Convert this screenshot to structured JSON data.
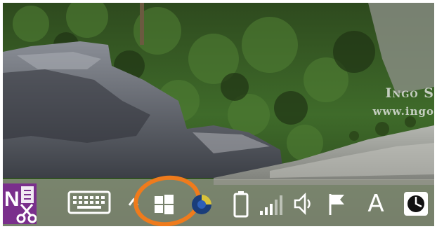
{
  "wallpaper": {
    "watermark_line1": "Ingo S",
    "watermark_line2": "www.ingo"
  },
  "taskbar": {
    "items": [
      {
        "name": "onenote-icon",
        "letter": "N"
      },
      {
        "name": "touch-keyboard-icon"
      },
      {
        "name": "show-hidden-icons-chevron-icon"
      },
      {
        "name": "windows-start-icon"
      },
      {
        "name": "app-tray-icon"
      },
      {
        "name": "battery-icon"
      },
      {
        "name": "network-signal-icon"
      },
      {
        "name": "volume-icon"
      },
      {
        "name": "action-center-flag-icon"
      },
      {
        "name": "input-font-icon",
        "glyph": "A"
      },
      {
        "name": "clock-app-icon"
      }
    ],
    "annotation_color": "#ef7b1c"
  }
}
